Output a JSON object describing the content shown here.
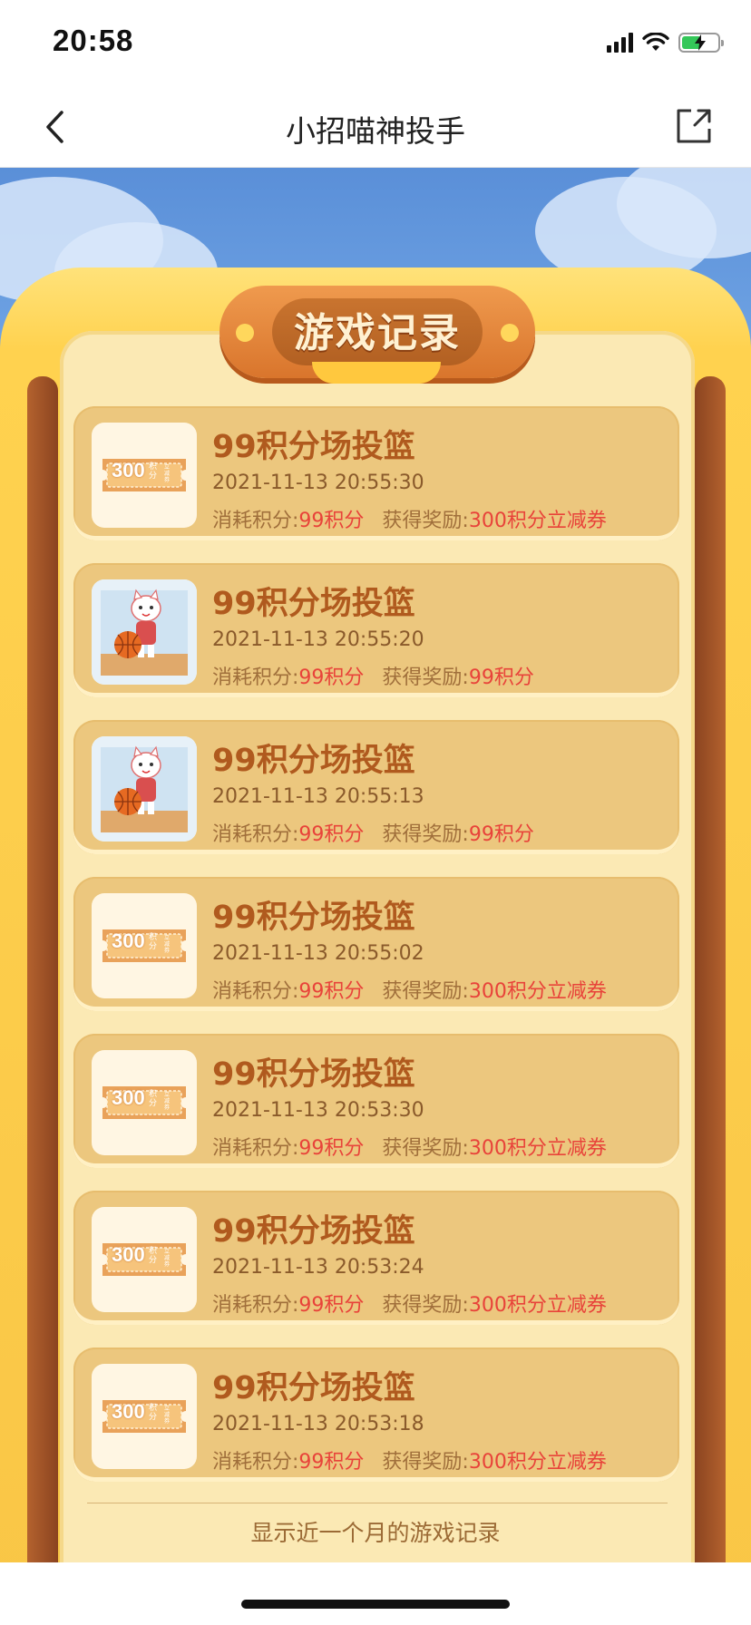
{
  "status_bar": {
    "time": "20:58",
    "icons": [
      "signal-icon",
      "wifi-icon",
      "battery-charging-icon"
    ]
  },
  "nav": {
    "title": "小招喵神投手",
    "back_icon": "chevron-left-icon",
    "share_icon": "share-icon"
  },
  "header": {
    "title": "游戏记录"
  },
  "records": [
    {
      "title": "99积分场投篮",
      "time": "2021-11-13 20:55:30",
      "cost_label": "消耗积分:",
      "cost_value": "99积分",
      "reward_label": "获得奖励:",
      "reward_value": "300积分立减券",
      "thumb": "coupon",
      "coupon_amount": "300",
      "coupon_unit": "积分",
      "coupon_text": "立减券"
    },
    {
      "title": "99积分场投篮",
      "time": "2021-11-13 20:55:20",
      "cost_label": "消耗积分:",
      "cost_value": "99积分",
      "reward_label": "获得奖励:",
      "reward_value": "99积分",
      "thumb": "cat-basketball"
    },
    {
      "title": "99积分场投篮",
      "time": "2021-11-13 20:55:13",
      "cost_label": "消耗积分:",
      "cost_value": "99积分",
      "reward_label": "获得奖励:",
      "reward_value": "99积分",
      "thumb": "cat-basketball"
    },
    {
      "title": "99积分场投篮",
      "time": "2021-11-13 20:55:02",
      "cost_label": "消耗积分:",
      "cost_value": "99积分",
      "reward_label": "获得奖励:",
      "reward_value": "300积分立减券",
      "thumb": "coupon",
      "coupon_amount": "300",
      "coupon_unit": "积分",
      "coupon_text": "立减券"
    },
    {
      "title": "99积分场投篮",
      "time": "2021-11-13 20:53:30",
      "cost_label": "消耗积分:",
      "cost_value": "99积分",
      "reward_label": "获得奖励:",
      "reward_value": "300积分立减券",
      "thumb": "coupon",
      "coupon_amount": "300",
      "coupon_unit": "积分",
      "coupon_text": "立减券"
    },
    {
      "title": "99积分场投篮",
      "time": "2021-11-13 20:53:24",
      "cost_label": "消耗积分:",
      "cost_value": "99积分",
      "reward_label": "获得奖励:",
      "reward_value": "300积分立减券",
      "thumb": "coupon",
      "coupon_amount": "300",
      "coupon_unit": "积分",
      "coupon_text": "立减券"
    },
    {
      "title": "99积分场投篮",
      "time": "2021-11-13 20:53:18",
      "cost_label": "消耗积分:",
      "cost_value": "99积分",
      "reward_label": "获得奖励:",
      "reward_value": "300积分立减券",
      "thumb": "coupon",
      "coupon_amount": "300",
      "coupon_unit": "积分",
      "coupon_text": "立减券"
    }
  ],
  "footer": {
    "note": "显示近一个月的游戏记录"
  },
  "colors": {
    "accent_red": "#e8433a",
    "title_brown": "#b05a1e",
    "card_bg": "#ecc77e",
    "sky_blue": "#5a8fd8"
  }
}
